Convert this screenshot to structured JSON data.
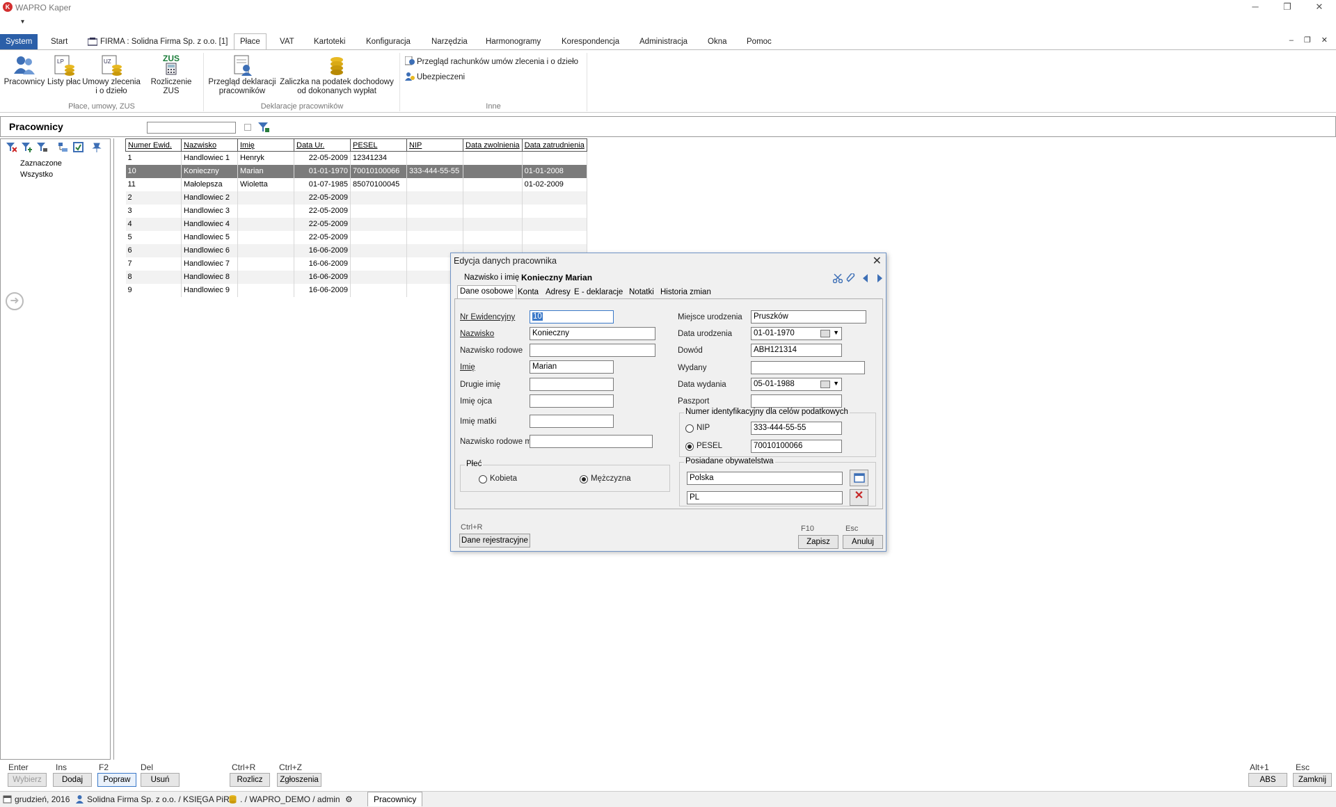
{
  "app": {
    "title": "WAPRO Kaper",
    "logo_letter": "K"
  },
  "window_controls": {
    "minimize": "─",
    "restore": "❐",
    "close": "✕"
  },
  "qat": "▾",
  "menu": {
    "tabs": [
      "System",
      "Start",
      "FIRMA : Solidna Firma Sp. z o.o. [1]",
      "Płace",
      "VAT",
      "Kartoteki",
      "Konfiguracja",
      "Narzędzia",
      "Harmonogramy",
      "Korespondencja",
      "Administracja",
      "Okna",
      "Pomoc"
    ],
    "mdi_controls": "– ❐ ✕"
  },
  "ribbon": {
    "buttons": {
      "pracownicy": "Pracownicy",
      "listy_plac": "Listy płac",
      "umowy_1": "Umowy zlecenia",
      "umowy_2": "i o dzieło",
      "zus_top": "ZUS",
      "rozliczenie_zus": "Rozliczenie ZUS",
      "przeglad_1": "Przegląd deklaracji",
      "przeglad_2": "pracowników",
      "zaliczka_1": "Zaliczka na podatek dochodowy",
      "zaliczka_2": "od dokonanych wypłat",
      "przeglad_rachunkow": "Przegląd rachunków umów zlecenia i o dzieło",
      "ubezpieczeni": "Ubezpieczeni"
    },
    "groups": {
      "g1": "Płace, umowy, ZUS",
      "g2": "Deklaracje pracowników",
      "g3": "Inne"
    }
  },
  "panel": {
    "title": "Pracownicy",
    "search_value": ""
  },
  "tree": {
    "zaznaczone": "Zaznaczone",
    "wszystko": "Wszystko"
  },
  "grid": {
    "columns": [
      "Numer Ewid.",
      "Nazwisko",
      "Imię",
      "Data Ur.",
      "PESEL",
      "NIP",
      "Data zwolnienia",
      "Data zatrudnienia"
    ],
    "rows": [
      [
        "1",
        "Handlowiec 1",
        "Henryk",
        "22-05-2009",
        "12341234",
        "",
        "",
        ""
      ],
      [
        "10",
        "Konieczny",
        "Marian",
        "01-01-1970",
        "70010100066",
        "333-444-55-55",
        "",
        "01-01-2008"
      ],
      [
        "11",
        "Małolepsza",
        "Wioletta",
        "01-07-1985",
        "85070100045",
        "",
        "",
        "01-02-2009"
      ],
      [
        "2",
        "Handlowiec 2",
        "",
        "22-05-2009",
        "",
        "",
        "",
        ""
      ],
      [
        "3",
        "Handlowiec 3",
        "",
        "22-05-2009",
        "",
        "",
        "",
        ""
      ],
      [
        "4",
        "Handlowiec 4",
        "",
        "22-05-2009",
        "",
        "",
        "",
        ""
      ],
      [
        "5",
        "Handlowiec 5",
        "",
        "22-05-2009",
        "",
        "",
        "",
        ""
      ],
      [
        "6",
        "Handlowiec 6",
        "",
        "16-06-2009",
        "",
        "",
        "",
        ""
      ],
      [
        "7",
        "Handlowiec 7",
        "",
        "16-06-2009",
        "",
        "",
        "",
        ""
      ],
      [
        "8",
        "Handlowiec 8",
        "",
        "16-06-2009",
        "",
        "",
        "",
        ""
      ],
      [
        "9",
        "Handlowiec 9",
        "",
        "16-06-2009",
        "",
        "",
        "",
        ""
      ]
    ]
  },
  "dialog": {
    "title": "Edycja danych pracownika",
    "close": "✕",
    "name_label": "Nazwisko i imię",
    "name_value": "Konieczny Marian",
    "tabs": [
      "Dane osobowe",
      "Konta",
      "Adresy",
      "E - deklaracje",
      "Notatki",
      "Historia zmian"
    ],
    "fields": {
      "nr_ewid_label": "Nr Ewidencyjny",
      "nr_ewid": "10",
      "nazwisko_label": "Nazwisko",
      "nazwisko": "Konieczny",
      "nazwisko_rodowe_label": "Nazwisko rodowe",
      "nazwisko_rodowe": "",
      "imie_label": "Imię",
      "imie": "Marian",
      "drugie_imie_label": "Drugie imię",
      "drugie_imie": "",
      "imie_ojca_label": "Imię ojca",
      "imie_ojca": "",
      "imie_matki_label": "Imię matki",
      "imie_matki": "",
      "nazwisko_rodowe_matki_label": "Nazwisko rodowe matki",
      "nazwisko_rodowe_matki": "",
      "miejsce_ur_label": "Miejsce urodzenia",
      "miejsce_ur": "Pruszków",
      "data_ur_label": "Data urodzenia",
      "data_ur": "01-01-1970",
      "dowod_label": "Dowód",
      "dowod": "ABH121314",
      "wydany_label": "Wydany",
      "wydany": "",
      "data_wydania_label": "Data wydania",
      "data_wydania": "05-01-1988",
      "paszport_label": "Paszport",
      "paszport": ""
    },
    "plec": {
      "label": "Płeć",
      "kobieta": "Kobieta",
      "mezczyzna": "Mężczyzna",
      "selected": "Mężczyzna"
    },
    "nip_group": {
      "label": "Numer identyfikacyjny dla celów podatkowych",
      "nip_label": "NIP",
      "nip": "333-444-55-55",
      "pesel_label": "PESEL",
      "pesel": "70010100066",
      "selected": "PESEL"
    },
    "obywatelstwo": {
      "label": "Posiadane obywatelstwa",
      "country": "Polska",
      "code": "PL"
    },
    "footer": {
      "ctrl_r": "Ctrl+R",
      "dane_rej": "Dane rejestracyjne",
      "f10": "F10",
      "zapisz": "Zapisz",
      "esc": "Esc",
      "anuluj": "Anuluj"
    }
  },
  "bottom": {
    "keys": {
      "enter": "Enter",
      "ins": "Ins",
      "f2": "F2",
      "del": "Del",
      "ctrl_r": "Ctrl+R",
      "ctrl_z": "Ctrl+Z",
      "alt1": "Alt+1",
      "esc": "Esc"
    },
    "buttons": {
      "wybierz": "Wybierz",
      "dodaj": "Dodaj",
      "popraw": "Popraw",
      "usun": "Usuń",
      "rozlicz": "Rozlicz",
      "zgloszenia": "Zgłoszenia",
      "abs": "ABS",
      "zamknij": "Zamknij"
    }
  },
  "status": {
    "period": "grudzień, 2016",
    "firm": "Solidna Firma Sp. z o.o. / KSIĘGA PiR",
    "db": ". / WAPRO_DEMO / admin",
    "tab": "Pracownicy"
  }
}
